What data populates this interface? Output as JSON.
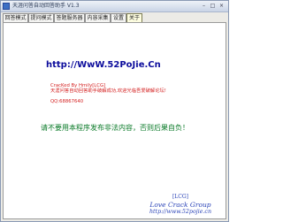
{
  "window": {
    "title": "天涯问答自动回答助手 V1.3",
    "controls": {
      "minimize": "–",
      "maximize": "□",
      "close": "×"
    }
  },
  "tabs": [
    {
      "label": "回答模式",
      "active": false
    },
    {
      "label": "提问模式",
      "active": false
    },
    {
      "label": "答题服务器",
      "active": false
    },
    {
      "label": "内容采集",
      "active": false
    },
    {
      "label": "设置",
      "active": false
    },
    {
      "label": "关于",
      "active": true
    }
  ],
  "about": {
    "site_url": "http://WwW.52PoJie.Cn",
    "credit_line1": "CracKed By Hmily[LCG]",
    "credit_line2": "天涯问答自动回答助手破解成功,欢迎光临吾爱破解论坛!",
    "qq": "QQ:68867640",
    "warning": "请不要用本程序发布非法内容，否则后果自负！",
    "signature": {
      "tag": "[LCG]",
      "name": "Love Crack Group",
      "link": "http://www.52pojie.cn"
    }
  },
  "colors": {
    "url": "#0c0c9c",
    "credit": "#d42020",
    "warning": "#0a7a28",
    "signature": "#2b44b8"
  }
}
